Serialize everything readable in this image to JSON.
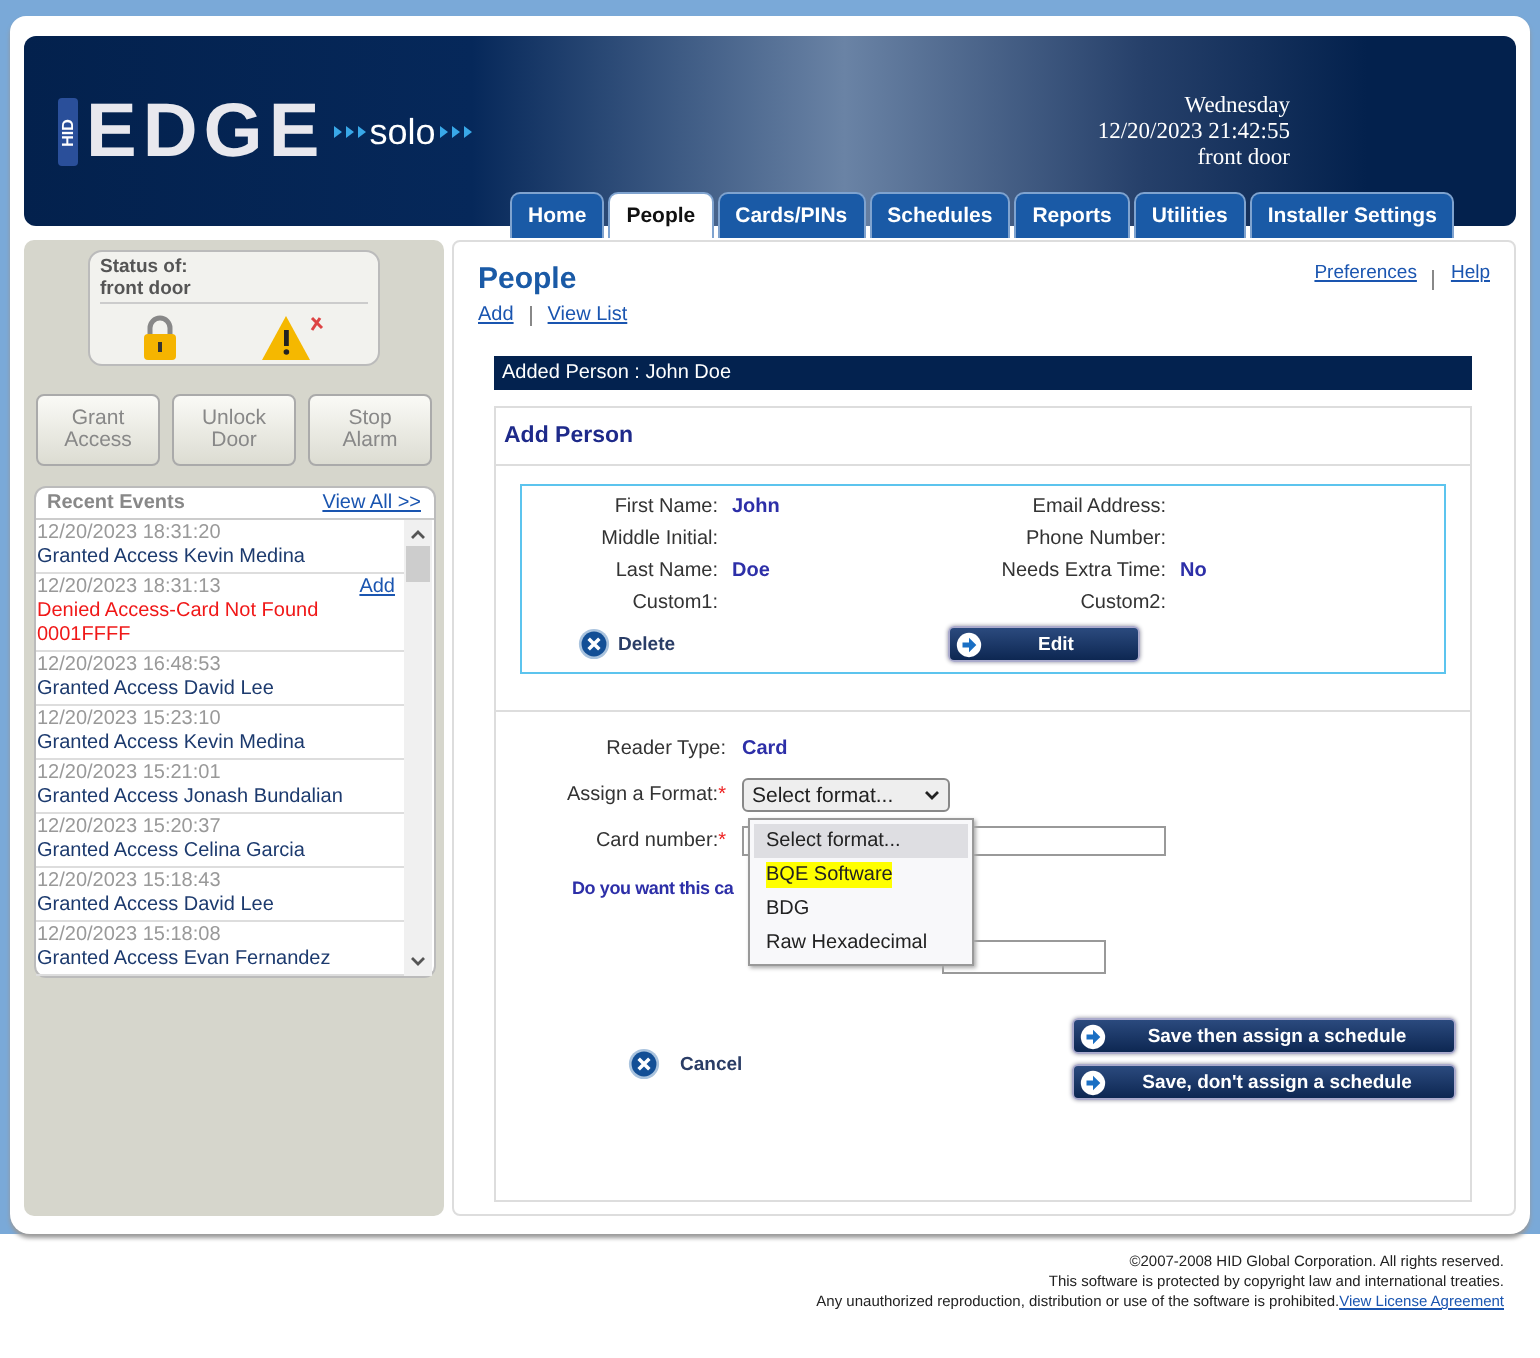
{
  "logo": {
    "brand": "HID",
    "product": "EDGE",
    "edition": "solo"
  },
  "header_info": [
    "Wednesday",
    "12/20/2023 21:42:55",
    "front door"
  ],
  "tabs": [
    {
      "label": "Home",
      "selected": false
    },
    {
      "label": "People",
      "selected": true
    },
    {
      "label": "Cards/PINs",
      "selected": false
    },
    {
      "label": "Schedules",
      "selected": false
    },
    {
      "label": "Reports",
      "selected": false
    },
    {
      "label": "Utilities",
      "selected": false
    },
    {
      "label": "Installer Settings",
      "selected": false
    }
  ],
  "sidebar": {
    "status_title": [
      "Status of:",
      "front door"
    ],
    "buttons": [
      [
        "Grant",
        "Access"
      ],
      [
        "Unlock",
        "Door"
      ],
      [
        "Stop",
        "Alarm"
      ]
    ],
    "events_title": "Recent Events",
    "view_all": "View All >>",
    "events": [
      {
        "time": "12/20/2023 18:31:20",
        "text": "Granted Access Kevin Medina",
        "kind": "granted"
      },
      {
        "time": "12/20/2023 18:31:13",
        "text": "Denied Access-Card Not Found 0001FFFF",
        "kind": "denied",
        "action": "Add"
      },
      {
        "time": "12/20/2023 16:48:53",
        "text": "Granted Access David Lee",
        "kind": "granted"
      },
      {
        "time": "12/20/2023 15:23:10",
        "text": "Granted Access Kevin Medina",
        "kind": "granted"
      },
      {
        "time": "12/20/2023 15:21:01",
        "text": "Granted Access Jonash Bundalian",
        "kind": "granted"
      },
      {
        "time": "12/20/2023 15:20:37",
        "text": "Granted Access Celina Garcia",
        "kind": "granted"
      },
      {
        "time": "12/20/2023 15:18:43",
        "text": "Granted Access David Lee",
        "kind": "granted"
      },
      {
        "time": "12/20/2023 15:18:08",
        "text": "Granted Access Evan Fernandez",
        "kind": "granted"
      }
    ]
  },
  "page": {
    "title": "People",
    "links": [
      "Add",
      "View List"
    ],
    "top_links": [
      "Preferences",
      "Help"
    ],
    "banner": "Added Person : John Doe",
    "section_title": "Add Person",
    "person_fields": [
      {
        "label": "First Name:",
        "value": "John"
      },
      {
        "label": "Email Address:"
      },
      {
        "label": "Middle Initial:"
      },
      {
        "label": "Phone Number:"
      },
      {
        "label": "Last Name:",
        "value": "Doe"
      },
      {
        "label": "Needs Extra Time:",
        "value": "No"
      },
      {
        "label": "Custom1:"
      },
      {
        "label": "Custom2:"
      }
    ],
    "delete": "Delete",
    "edit": "Edit",
    "reader_type": {
      "label": "Reader Type:",
      "value": "Card"
    },
    "format": {
      "label": "Assign a Format:",
      "required": "*",
      "value": "Select format...",
      "options": [
        {
          "label": "Select format...",
          "selected": true,
          "highlighted": false
        },
        {
          "label": "BQE Software",
          "selected": false,
          "highlighted": true
        },
        {
          "label": "BDG",
          "selected": false,
          "highlighted": false
        },
        {
          "label": "Raw Hexadecimal",
          "selected": false,
          "highlighted": false
        }
      ]
    },
    "card_number": {
      "label": "Card number:",
      "required": "*"
    },
    "question": "Do you want this ca",
    "cancel": "Cancel",
    "save_buttons": [
      "Save then assign a schedule",
      "Save, don't assign a schedule"
    ]
  },
  "footer": [
    "©2007-2008 HID Global Corporation. All rights reserved.",
    "This software is protected by copyright law and international treaties.",
    "Any unauthorized reproduction, distribution or use of the software is prohibited."
  ],
  "footer_link": "View License Agreement"
}
